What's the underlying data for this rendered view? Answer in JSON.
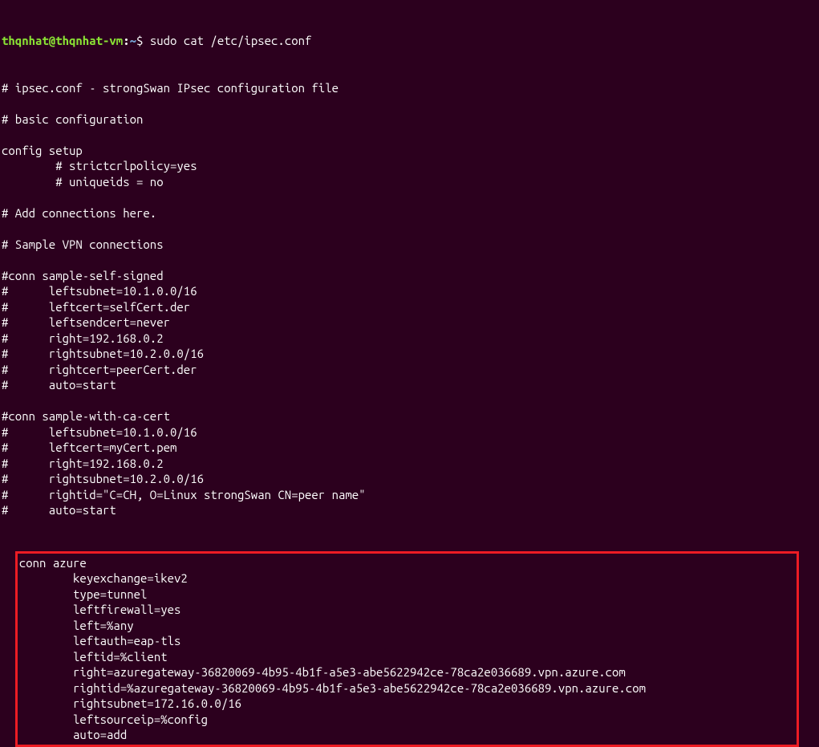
{
  "prompt": {
    "user_host": "thqnhat@thqnhat-vm",
    "colon": ":",
    "path": "~",
    "dollar": "$ ",
    "command": "sudo cat /etc/ipsec.conf"
  },
  "output": {
    "lines_before": [
      "# ipsec.conf - strongSwan IPsec configuration file",
      "",
      "# basic configuration",
      "",
      "config setup",
      "        # strictcrlpolicy=yes",
      "        # uniqueids = no",
      "",
      "# Add connections here.",
      "",
      "# Sample VPN connections",
      "",
      "#conn sample-self-signed",
      "#      leftsubnet=10.1.0.0/16",
      "#      leftcert=selfCert.der",
      "#      leftsendcert=never",
      "#      right=192.168.0.2",
      "#      rightsubnet=10.2.0.0/16",
      "#      rightcert=peerCert.der",
      "#      auto=start",
      "",
      "#conn sample-with-ca-cert",
      "#      leftsubnet=10.1.0.0/16",
      "#      leftcert=myCert.pem",
      "#      right=192.168.0.2",
      "#      rightsubnet=10.2.0.0/16",
      "#      rightid=\"C=CH, O=Linux strongSwan CN=peer name\"",
      "#      auto=start",
      ""
    ],
    "highlighted_lines": [
      "conn azure",
      "        keyexchange=ikev2",
      "        type=tunnel",
      "        leftfirewall=yes",
      "        left=%any",
      "        leftauth=eap-tls",
      "        leftid=%client",
      "        right=azuregateway-36820069-4b95-4b1f-a5e3-abe5622942ce-78ca2e036689.vpn.azure.com",
      "        rightid=%azuregateway-36820069-4b95-4b1f-a5e3-abe5622942ce-78ca2e036689.vpn.azure.com",
      "        rightsubnet=172.16.0.0/16",
      "        leftsourceip=%config",
      "        auto=add"
    ]
  }
}
